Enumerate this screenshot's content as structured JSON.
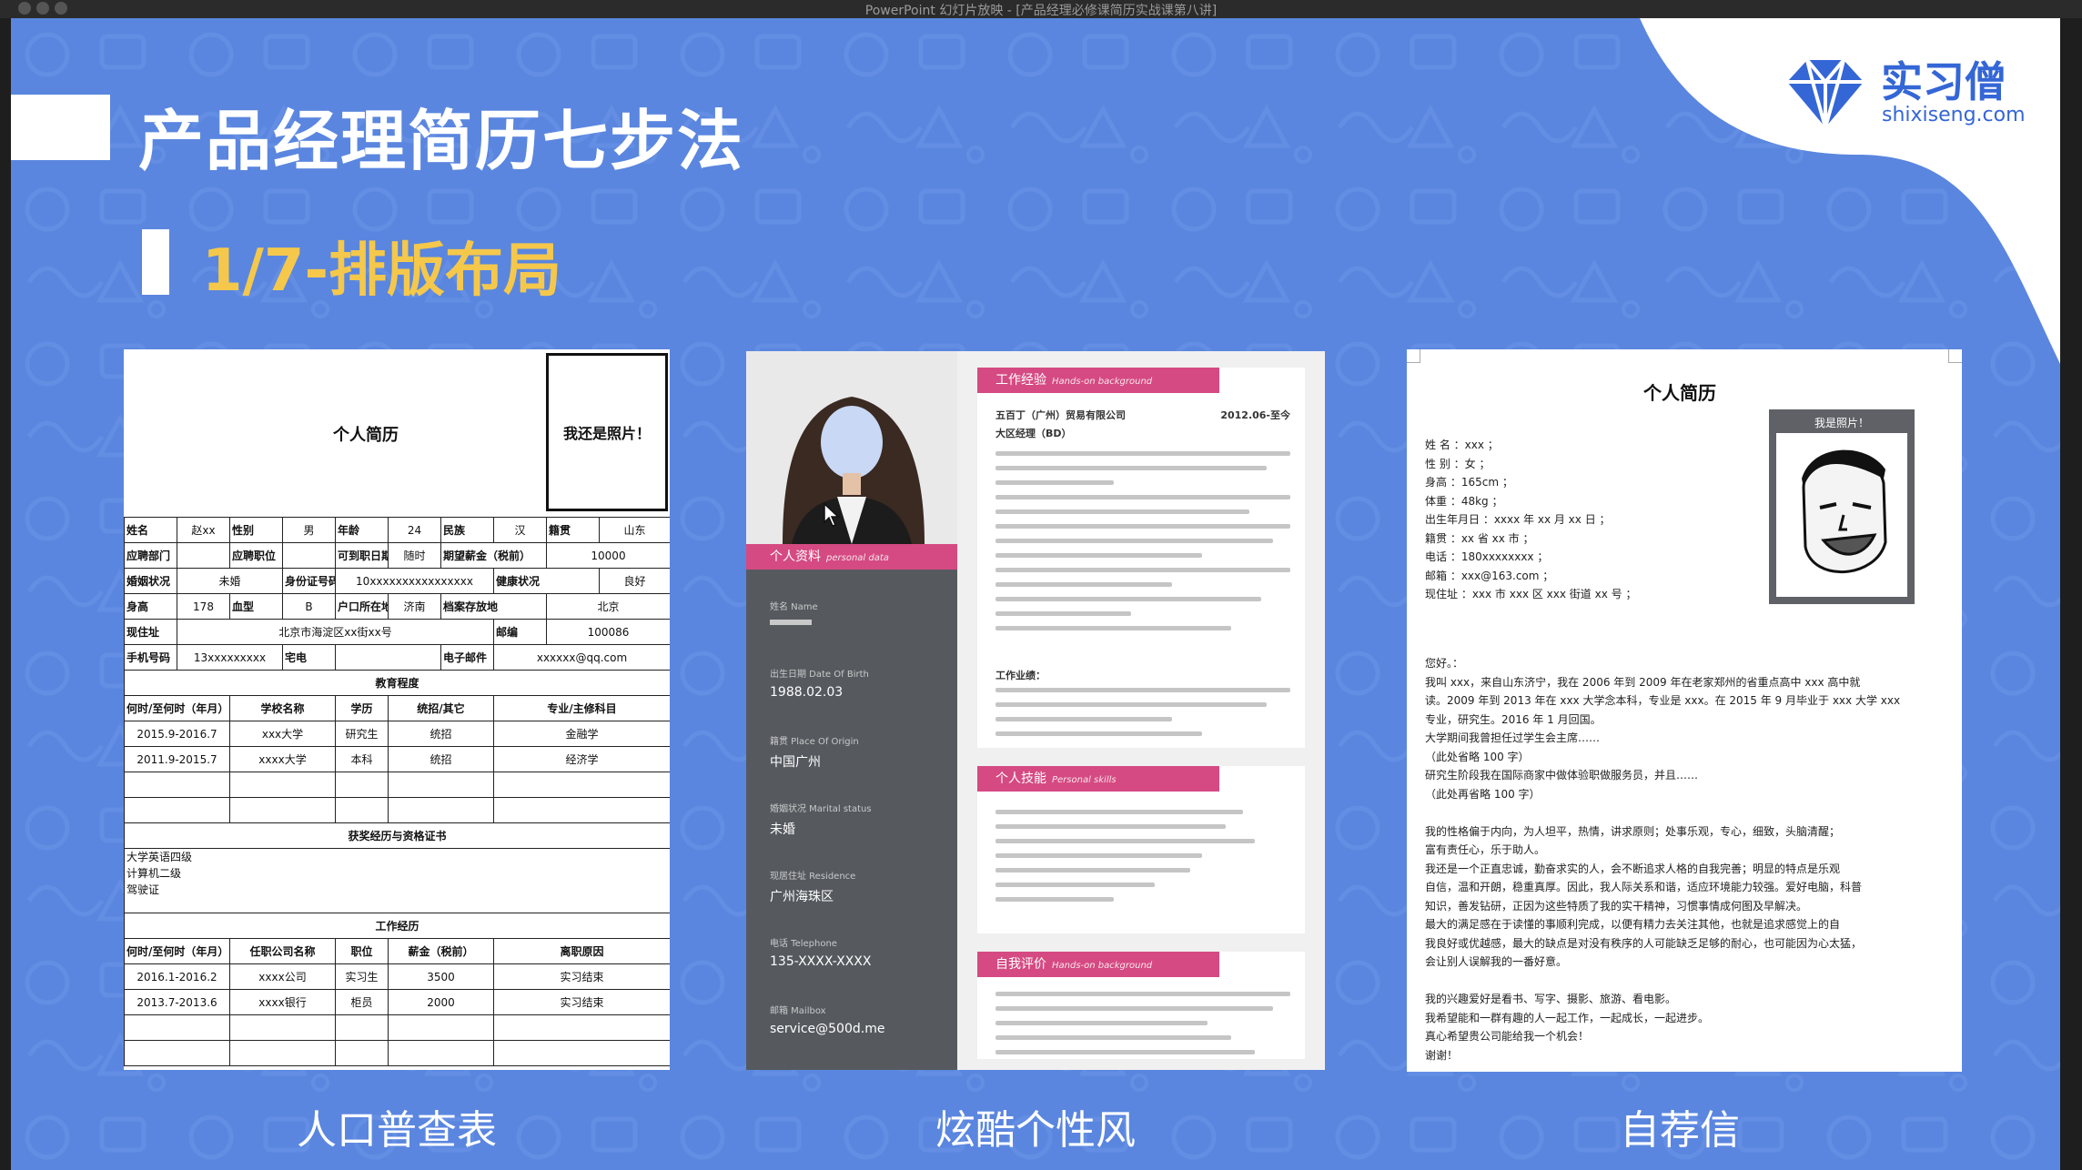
{
  "window": {
    "title": "PowerPoint 幻灯片放映 - [产品经理必修课简历实战课第八讲]"
  },
  "slide": {
    "main_title": "产品经理简历七步法",
    "sub_title": "1/7-排版布局",
    "logo": {
      "brand": "实习僧",
      "url": "shixiseng.com"
    },
    "captions": [
      "人口普查表",
      "炫酷个性风",
      "自荐信"
    ]
  },
  "card1": {
    "title": "个人简历",
    "photo_label": "我还是照片！",
    "rows": [
      [
        "姓名",
        "赵xx",
        "性别",
        "男",
        "年龄",
        "24",
        "民族",
        "汉",
        "籍贯",
        "山东"
      ],
      [
        "应聘部门",
        "",
        "应聘职位",
        "",
        "可到职日期",
        "随时",
        "期望薪金（税前）",
        "10000"
      ],
      [
        "婚姻状况",
        "未婚",
        "身份证号码",
        "10xxxxxxxxxxxxxxxx",
        "健康状况",
        "良好"
      ],
      [
        "身高",
        "178",
        "血型",
        "B",
        "户口所在地",
        "济南",
        "档案存放地",
        "北京"
      ],
      [
        "现住址",
        "北京市海淀区xx街xx号",
        "邮编",
        "100086"
      ],
      [
        "手机号码",
        "13xxxxxxxxx",
        "宅电",
        "",
        "电子邮件",
        "xxxxxx@qq.com"
      ]
    ],
    "edu_title": "教育程度",
    "edu_header": [
      "何时/至何时（年月）",
      "学校名称",
      "学历",
      "统招/其它",
      "专业/主修科目"
    ],
    "edu_rows": [
      [
        "2015.9-2016.7",
        "xxx大学",
        "研究生",
        "统招",
        "金融学"
      ],
      [
        "2011.9-2015.7",
        "xxxx大学",
        "本科",
        "统招",
        "经济学"
      ]
    ],
    "cert_title": "获奖经历与资格证书",
    "certs": [
      "大学英语四级",
      "计算机二级",
      "驾驶证"
    ],
    "work_title": "工作经历",
    "work_header": [
      "何时/至何时（年月）",
      "任职公司名称",
      "职位",
      "薪金（税前）",
      "离职原因"
    ],
    "work_rows": [
      [
        "2016.1-2016.2",
        "xxxx公司",
        "实习生",
        "3500",
        "实习结束"
      ],
      [
        "2013.7-2013.6",
        "xxxx银行",
        "柜员",
        "2000",
        "实习结束"
      ]
    ]
  },
  "card2": {
    "profile_band": "个人资料",
    "profile_band_en": "personal data",
    "fields": [
      {
        "key": "姓名 Name",
        "value": ""
      },
      {
        "key": "出生日期 Date Of Birth",
        "value": "1988.02.03"
      },
      {
        "key": "籍贯 Place Of Origin",
        "value": "中国广州"
      },
      {
        "key": "婚姻状况 Marital status",
        "value": "未婚"
      },
      {
        "key": "现居住址 Residence",
        "value": "广州海珠区"
      },
      {
        "key": "电话 Telephone",
        "value": "135-XXXX-XXXX"
      },
      {
        "key": "邮箱 Mailbox",
        "value": "service@500d.me"
      }
    ],
    "sections": [
      {
        "title": "工作经验",
        "en": "Hands-on background"
      },
      {
        "title": "个人技能",
        "en": "Personal skills"
      },
      {
        "title": "自我评价",
        "en": "Hands-on background"
      }
    ],
    "job_company": "五百丁（广州）贸易有限公司",
    "job_date": "2012.06-至今",
    "job_role": "大区经理（BD）",
    "job_perf_label": "工作业绩："
  },
  "card3": {
    "title": "个人简历",
    "photo_label": "我是照片！",
    "info": [
      "姓 名 ：xxx ；",
      "性 别 ：女 ；",
      "身高 ：165cm ；",
      "体重 ：48kg ；",
      "出生年月日 ：xxxx 年 xx 月 xx 日 ；",
      "籍贯 ：xx 省 xx 市 ；",
      "电话 ：180xxxxxxxx ；",
      "邮箱 ：xxx@163.com ；",
      "现住址 ：xxx 市 xxx 区 xxx 街道 xx 号 ；"
    ],
    "body": [
      "您好。：",
      "    我叫 xxx，来自山东济宁，我在 2006 年到 2009 年在老家郑州的省重点高中 xxx 高中就",
      "读。2009 年到 2013 年在 xxx 大学念本科，专业是 xxx。在 2015 年 9 月毕业于 xxx 大学 xxx",
      "专业，研究生。2016 年 1 月回国。",
      "    大学期间我曾担任过学生会主席……",
      "    （此处省略 100 字）",
      "    研究生阶段我在国际商家中做体验职做服务员，并且……",
      "    （此处再省略 100 字）",
      "",
      "    我的性格偏于内向，为人坦平，热情，讲求原则；处事乐观，专心，细致，头脑清醒；",
      "富有责任心，乐于助人。",
      "    我还是一个正直忠诚，勤奋求实的人，会不断追求人格的自我完善；明显的特点是乐观",
      "自信，温和开朗，稳重真厚。因此，我人际关系和谐，适应环境能力较强。爱好电脑，科普",
      "知识，善发钻研，正因为这些特质了我的实干精神，习惯事情成何图及早解决。",
      "    最大的满足感在于读懂的事顺利完成，以便有精力去关注其他，也就是追求感觉上的自",
      "我良好或优越感，最大的缺点是对没有秩序的人可能缺乏足够的耐心，也可能因为心太猛，",
      "会让别人误解我的一番好意。",
      "",
      "    我的兴趣爱好是看书、写字、摄影、旅游、看电影。",
      "    我希望能和一群有趣的人一起工作，一起成长，一起进步。",
      "    真心希望贵公司能给我一个机会！",
      "    谢谢！"
    ]
  },
  "colors": {
    "slide_bg": "#5a86df",
    "accent_yellow": "#f5c84b",
    "resume_pink": "#d54a82",
    "resume_dark": "#565a5f",
    "logo_blue": "#3466d6"
  }
}
